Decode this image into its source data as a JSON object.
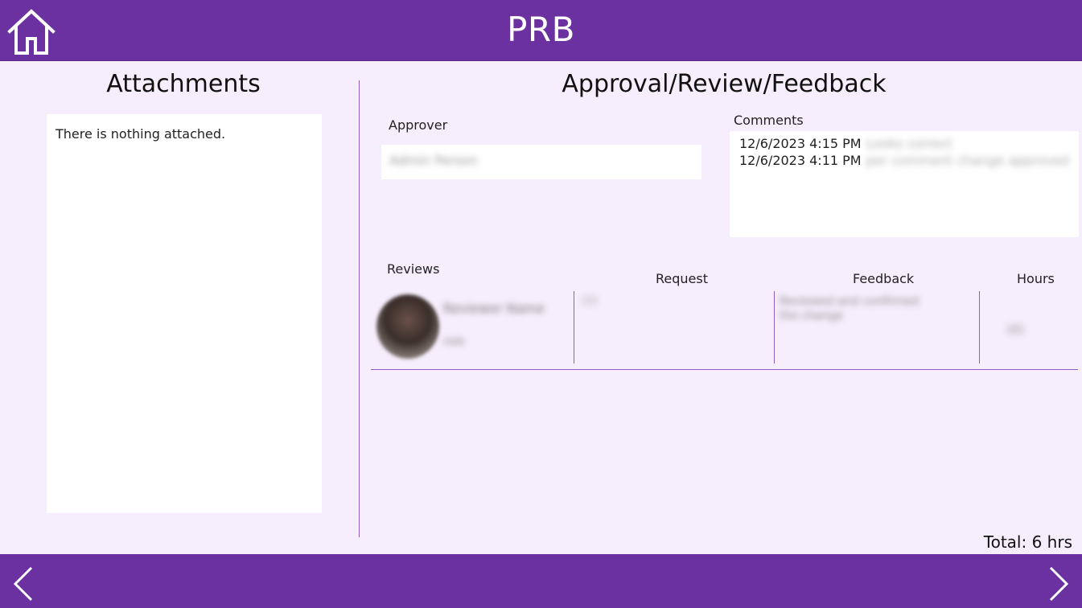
{
  "header": {
    "title": "PRB",
    "home_icon": "home-icon"
  },
  "attachments": {
    "title": "Attachments",
    "empty_text": "There is nothing attached."
  },
  "approval": {
    "title": "Approval/Review/Feedback",
    "approver_label": "Approver",
    "approver_value": "Admin Person",
    "comments_label": "Comments",
    "comments": [
      {
        "timestamp": "12/6/2023 4:15 PM",
        "text": "Looks correct"
      },
      {
        "timestamp": "12/6/2023 4:11 PM",
        "text": "per comment change approved"
      }
    ]
  },
  "reviews": {
    "label": "Reviews",
    "columns": {
      "request": "Request",
      "feedback": "Feedback",
      "hours": "Hours"
    },
    "rows": [
      {
        "reviewer_name": "Reviewer Name",
        "reviewer_sub": "role",
        "request": "(1)",
        "feedback": "Reviewed and confirmed the change",
        "hours": "(6)"
      }
    ]
  },
  "total": "Total: 6 hrs",
  "footer": {
    "prev_icon": "chevron-left-icon",
    "next_icon": "chevron-right-icon"
  },
  "colors": {
    "brand": "#6B31A1",
    "background": "#F6EEFC",
    "divider": "#8E5EC2"
  }
}
